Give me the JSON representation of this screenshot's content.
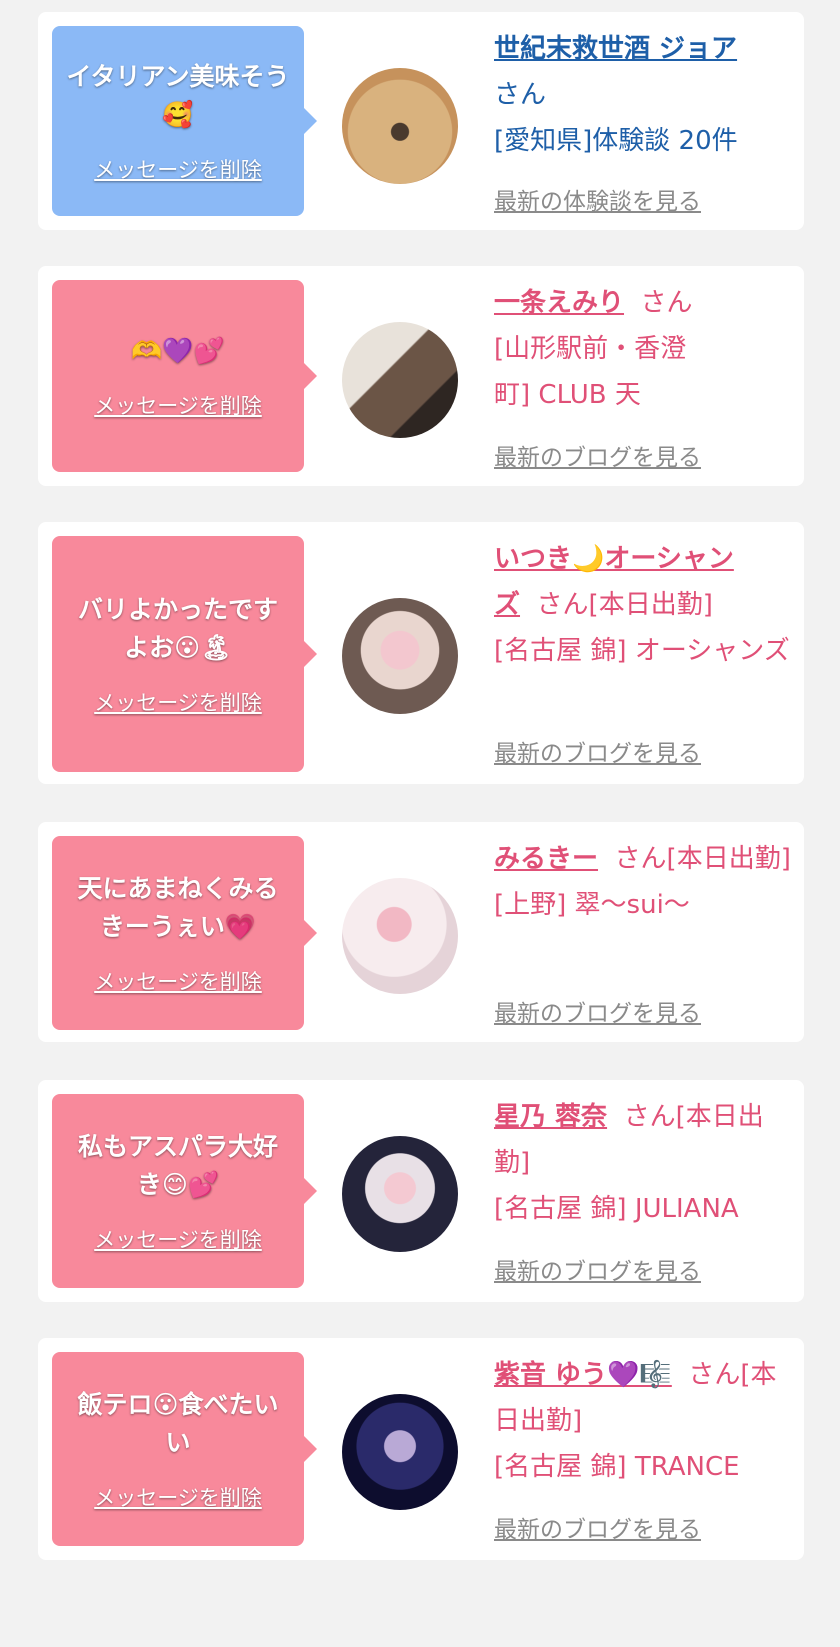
{
  "delete_label": "メッセージを削除",
  "colors": {
    "blue_bubble": "#8bb9f6",
    "pink_bubble": "#f8899b",
    "blue_text": "#1e5fa8",
    "pink_text": "#e05077"
  },
  "cards": [
    {
      "message": "イタリアン美味そう🥰",
      "name": "世紀末救世酒 ジョア",
      "suffix": "さん",
      "location": "[愛知県]体験談 20件",
      "latest_link": "最新の体験談を見る"
    },
    {
      "message": "🫶💜💕",
      "name": "一条えみり",
      "suffix": "さん",
      "location": "[山形駅前・香澄町] CLUB 天",
      "latest_link": "最新のブログを見る"
    },
    {
      "message": "バリよかったですよお😮🏝",
      "name": "いつき🌙オーシャンズ",
      "suffix": "さん[本日出勤]",
      "location": "[名古屋 錦] オーシャンズ",
      "latest_link": "最新のブログを見る"
    },
    {
      "message": "天にあまねくみるきーうぇい💗",
      "name": "みるきー",
      "suffix": "さん[本日出勤]",
      "location": "[上野] 翠〜sui〜",
      "latest_link": "最新のブログを見る"
    },
    {
      "message": "私もアスパラ大好き😊💕",
      "name": "星乃 蓉奈",
      "suffix": "さん[本日出勤]",
      "location": "[名古屋 錦] JULIANA",
      "latest_link": "最新のブログを見る"
    },
    {
      "message": "飯テロ😮食べたいい",
      "name": "紫音 ゆう💜🎼",
      "suffix": "さん[本日出勤]",
      "location": "[名古屋 錦] TRANCE",
      "latest_link": "最新のブログを見る"
    }
  ]
}
